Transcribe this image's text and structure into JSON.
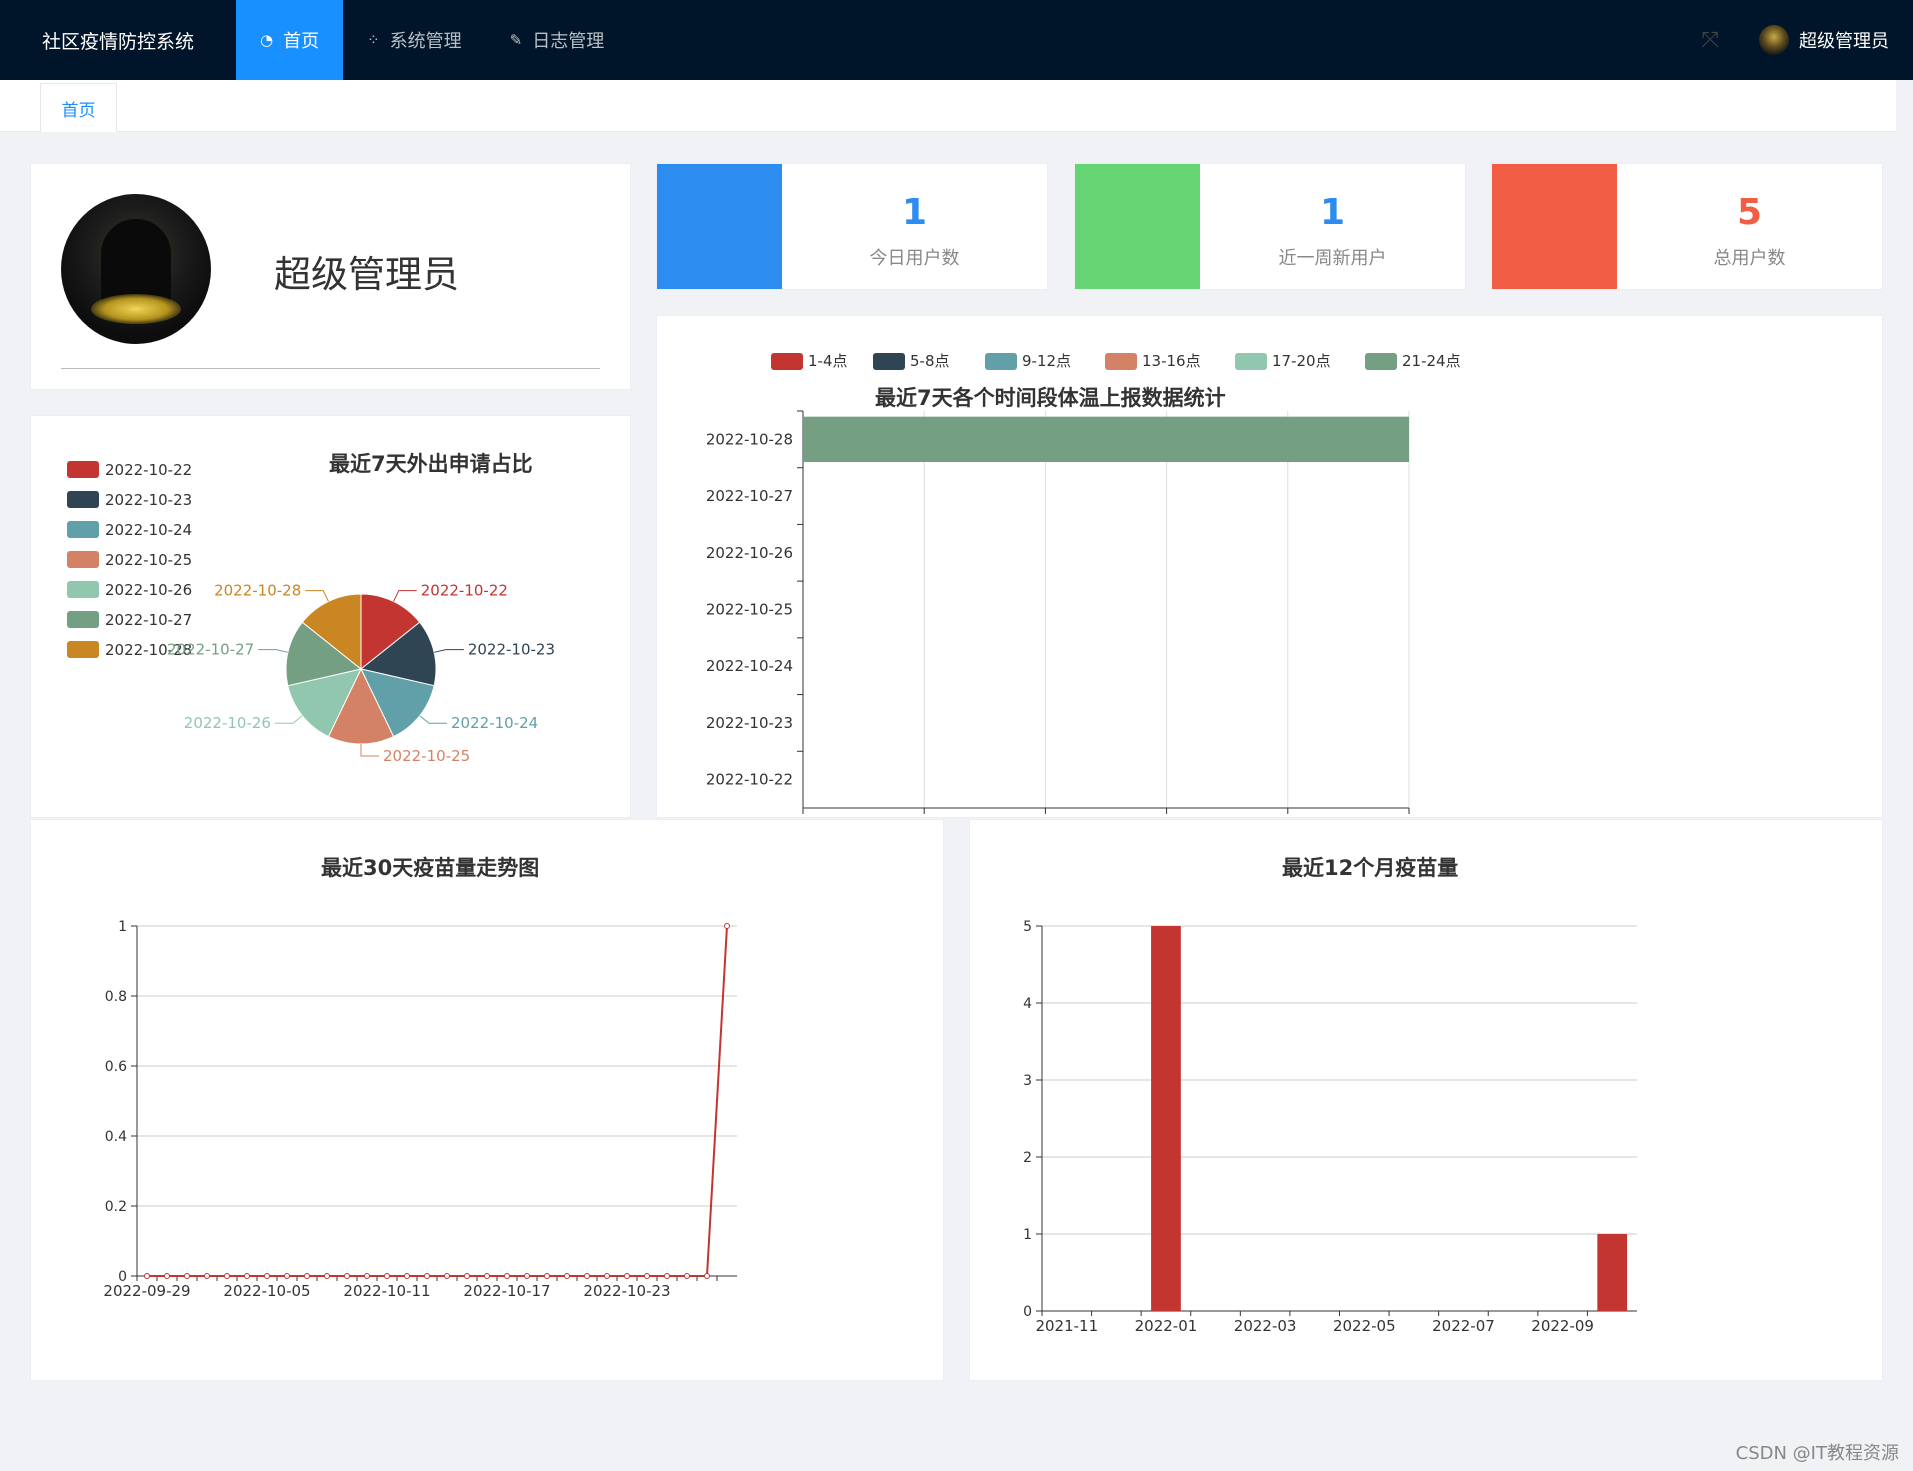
{
  "app": {
    "title": "社区疫情防控系统"
  },
  "nav": {
    "items": [
      {
        "label": "首页",
        "icon": "dashboard-icon",
        "active": true
      },
      {
        "label": "系统管理",
        "icon": "apps-icon",
        "active": false
      },
      {
        "label": "日志管理",
        "icon": "edit-icon",
        "active": false
      }
    ]
  },
  "header": {
    "user_name": "超级管理员",
    "fullscreen_icon": "fullscreen-icon"
  },
  "tabs": [
    {
      "label": "首页"
    }
  ],
  "profile": {
    "name": "超级管理员"
  },
  "stats": [
    {
      "value": "1",
      "label": "今日用户数",
      "color": "#2d8cf0",
      "value_color": "#2d8cf0"
    },
    {
      "value": "1",
      "label": "近一周新用户",
      "color": "#64d572",
      "value_color": "#2d8cf0"
    },
    {
      "value": "5",
      "label": "总用户数",
      "color": "#f25e43",
      "value_color": "#f25e43"
    }
  ],
  "chart_data": [
    {
      "type": "pie",
      "title": "最近7天外出申请占比",
      "legend_position": "top-left",
      "categories": [
        "2022-10-22",
        "2022-10-23",
        "2022-10-24",
        "2022-10-25",
        "2022-10-26",
        "2022-10-27",
        "2022-10-28"
      ],
      "values": [
        1,
        1,
        1,
        1,
        1,
        1,
        1
      ],
      "colors": [
        "#c23531",
        "#2f4554",
        "#61a0a8",
        "#d48265",
        "#91c7ae",
        "#749f83",
        "#ca8622"
      ]
    },
    {
      "type": "bar",
      "orientation": "horizontal",
      "stacked": true,
      "title": "最近7天各个时间段体温上报数据统计",
      "legend_position": "top",
      "categories": [
        "2022-10-22",
        "2022-10-23",
        "2022-10-24",
        "2022-10-25",
        "2022-10-26",
        "2022-10-27",
        "2022-10-28"
      ],
      "series": [
        {
          "name": "1-4点",
          "color": "#c23531",
          "values": [
            0,
            0,
            0,
            0,
            0,
            0,
            0
          ]
        },
        {
          "name": "5-8点",
          "color": "#2f4554",
          "values": [
            0,
            0,
            0,
            0,
            0,
            0,
            0
          ]
        },
        {
          "name": "9-12点",
          "color": "#61a0a8",
          "values": [
            0,
            0,
            0,
            0,
            0,
            0,
            0
          ]
        },
        {
          "name": "13-16点",
          "color": "#d48265",
          "values": [
            0,
            0,
            0,
            0,
            0,
            0,
            0
          ]
        },
        {
          "name": "17-20点",
          "color": "#91c7ae",
          "values": [
            0,
            0,
            0,
            0,
            0,
            0,
            0
          ]
        },
        {
          "name": "21-24点",
          "color": "#749f83",
          "values": [
            0,
            0,
            0,
            0,
            0,
            0,
            1
          ]
        }
      ],
      "xlim": [
        0,
        1
      ],
      "grid": true
    },
    {
      "type": "line",
      "title": "最近30天疫苗量走势图",
      "x": [
        "2022-09-29",
        "2022-09-30",
        "2022-10-01",
        "2022-10-02",
        "2022-10-03",
        "2022-10-04",
        "2022-10-05",
        "2022-10-06",
        "2022-10-07",
        "2022-10-08",
        "2022-10-09",
        "2022-10-10",
        "2022-10-11",
        "2022-10-12",
        "2022-10-13",
        "2022-10-14",
        "2022-10-15",
        "2022-10-16",
        "2022-10-17",
        "2022-10-18",
        "2022-10-19",
        "2022-10-20",
        "2022-10-21",
        "2022-10-22",
        "2022-10-23",
        "2022-10-24",
        "2022-10-25",
        "2022-10-26",
        "2022-10-27",
        "2022-10-28"
      ],
      "values": [
        0,
        0,
        0,
        0,
        0,
        0,
        0,
        0,
        0,
        0,
        0,
        0,
        0,
        0,
        0,
        0,
        0,
        0,
        0,
        0,
        0,
        0,
        0,
        0,
        0,
        0,
        0,
        0,
        0,
        1
      ],
      "x_tick_labels": [
        "2022-09-29",
        "2022-10-05",
        "2022-10-11",
        "2022-10-17",
        "2022-10-23"
      ],
      "y_ticks": [
        "0",
        "0.2",
        "0.4",
        "0.6",
        "0.8",
        "1"
      ],
      "ylim": [
        0,
        1
      ],
      "color": "#c23531",
      "grid": true
    },
    {
      "type": "bar",
      "title": "最近12个月疫苗量",
      "categories": [
        "2021-11",
        "2021-12",
        "2022-01",
        "2022-02",
        "2022-03",
        "2022-04",
        "2022-05",
        "2022-06",
        "2022-07",
        "2022-08",
        "2022-09",
        "2022-10"
      ],
      "values": [
        0,
        0,
        5,
        0,
        0,
        0,
        0,
        0,
        0,
        0,
        0,
        1
      ],
      "x_tick_labels": [
        "2021-11",
        "2022-01",
        "2022-03",
        "2022-05",
        "2022-07",
        "2022-09"
      ],
      "y_ticks": [
        "0",
        "1",
        "2",
        "3",
        "4",
        "5"
      ],
      "ylim": [
        0,
        5
      ],
      "color": "#c23531",
      "grid": true
    }
  ],
  "watermark": "CSDN @IT教程资源"
}
